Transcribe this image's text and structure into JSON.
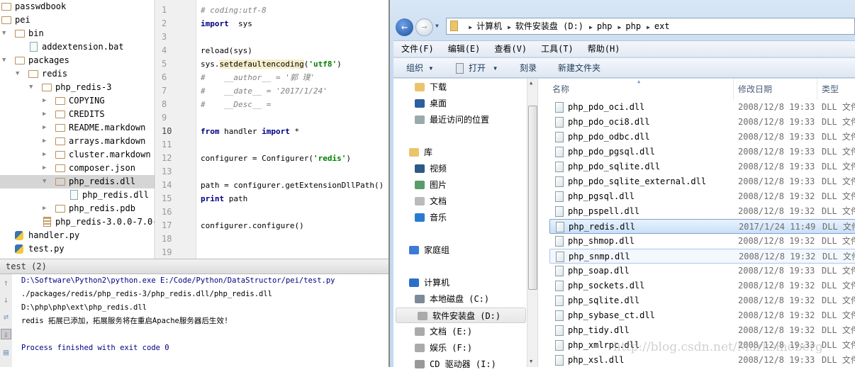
{
  "ide": {
    "tree": [
      {
        "label": "passwdbook",
        "depth": 0,
        "kind": "folder",
        "arrow": ""
      },
      {
        "label": "pei",
        "depth": 0,
        "kind": "folder",
        "arrow": ""
      },
      {
        "label": "bin",
        "depth": 1,
        "kind": "folder",
        "arrow": "▼"
      },
      {
        "label": "addextension.bat",
        "depth": 2,
        "kind": "file",
        "arrow": ""
      },
      {
        "label": "packages",
        "depth": 1,
        "kind": "folder",
        "arrow": "▼"
      },
      {
        "label": "redis",
        "depth": 2,
        "kind": "folder",
        "arrow": "▼"
      },
      {
        "label": "php_redis-3",
        "depth": 3,
        "kind": "folder",
        "arrow": "▼"
      },
      {
        "label": "COPYING",
        "depth": 4,
        "kind": "folder",
        "arrow": "▶"
      },
      {
        "label": "CREDITS",
        "depth": 4,
        "kind": "folder",
        "arrow": "▶"
      },
      {
        "label": "README.markdown",
        "depth": 4,
        "kind": "folder",
        "arrow": "▶"
      },
      {
        "label": "arrays.markdown",
        "depth": 4,
        "kind": "folder",
        "arrow": "▶"
      },
      {
        "label": "cluster.markdown",
        "depth": 4,
        "kind": "folder",
        "arrow": "▶"
      },
      {
        "label": "composer.json",
        "depth": 4,
        "kind": "folder",
        "arrow": "▶"
      },
      {
        "label": "php_redis.dll",
        "depth": 4,
        "kind": "folder",
        "arrow": "▼",
        "selected": true
      },
      {
        "label": "php_redis.dll",
        "depth": 5,
        "kind": "file",
        "arrow": ""
      },
      {
        "label": "php_redis.pdb",
        "depth": 4,
        "kind": "folder",
        "arrow": "▶"
      },
      {
        "label": "php_redis-3.0.0-7.0-",
        "depth": 3,
        "kind": "archive",
        "arrow": ""
      },
      {
        "label": "handler.py",
        "depth": 1,
        "kind": "py",
        "arrow": ""
      },
      {
        "label": "test.py",
        "depth": 1,
        "kind": "py",
        "arrow": ""
      }
    ],
    "current_line": 10,
    "code": [
      [
        [
          "cm",
          "# coding:utf-8"
        ]
      ],
      [
        [
          "kw",
          "import"
        ],
        [
          "",
          "  sys"
        ]
      ],
      [],
      [
        [
          "",
          "reload(sys)"
        ]
      ],
      [
        [
          "",
          "sys."
        ],
        [
          "hl",
          "setdefaultencoding"
        ],
        [
          "",
          "("
        ],
        [
          "str",
          "'utf8'"
        ],
        [
          "",
          ")"
        ]
      ],
      [
        [
          "cm",
          "#    __author__ = '郭 璞'"
        ]
      ],
      [
        [
          "cm",
          "#    __date__ = '2017/1/24'"
        ]
      ],
      [
        [
          "cm",
          "#    __Desc__ ="
        ]
      ],
      [],
      [
        [
          "kw",
          "from"
        ],
        [
          "",
          " handler "
        ],
        [
          "kw",
          "import"
        ],
        [
          "",
          " *"
        ]
      ],
      [],
      [
        [
          "",
          "configurer = Configurer("
        ],
        [
          "str",
          "'redis'"
        ],
        [
          "",
          ")"
        ]
      ],
      [],
      [
        [
          "",
          "path = configurer.getExtensionDllPath()"
        ]
      ],
      [
        [
          "kw",
          "print"
        ],
        [
          "",
          " path"
        ]
      ],
      [],
      [
        [
          "",
          "configurer.configure()"
        ]
      ],
      [],
      []
    ],
    "console": {
      "tab_label": "test (2)",
      "lines": [
        {
          "text": "D:\\Software\\Python2\\python.exe E:/Code/Python/DataStructor/pei/test.py",
          "color": "#000080"
        },
        {
          "text": "./packages/redis/php_redis-3/php_redis.dll/php_redis.dll",
          "color": "#000000"
        },
        {
          "text": "D:\\php\\php\\ext\\php_redis.dll",
          "color": "#000000"
        },
        {
          "text": "redis 拓展已添加，拓展服务将在重启Apache服务器后生效!",
          "color": "#000000"
        },
        {
          "text": "",
          "color": "#000000"
        },
        {
          "text": "Process finished with exit code 0",
          "color": "#000080"
        }
      ]
    }
  },
  "explorer": {
    "breadcrumb": [
      "计算机",
      "软件安装盘 (D:)",
      "php",
      "php",
      "ext"
    ],
    "menu": [
      "文件(F)",
      "编辑(E)",
      "查看(V)",
      "工具(T)",
      "帮助(H)"
    ],
    "toolbar": {
      "organize": "组织 ▾",
      "open": "打开",
      "open_caret": "▾",
      "burn": "刻录",
      "new_folder": "新建文件夹"
    },
    "nav": [
      {
        "label": "下载",
        "indent": 1,
        "icon": "download-folder-icon",
        "color": "#e9c46a"
      },
      {
        "label": "桌面",
        "indent": 1,
        "icon": "desktop-icon",
        "color": "#2c5fa0"
      },
      {
        "label": "最近访问的位置",
        "indent": 1,
        "icon": "recent-places-icon",
        "color": "#9aa"
      },
      {
        "label": "",
        "indent": 0,
        "icon": "",
        "color": ""
      },
      {
        "label": "库",
        "indent": 0,
        "icon": "library-icon",
        "color": "#e9c46a"
      },
      {
        "label": "视频",
        "indent": 1,
        "icon": "video-icon",
        "color": "#2b5a86"
      },
      {
        "label": "图片",
        "indent": 1,
        "icon": "pictures-icon",
        "color": "#5a9c6a"
      },
      {
        "label": "文档",
        "indent": 1,
        "icon": "documents-icon",
        "color": "#bbb"
      },
      {
        "label": "音乐",
        "indent": 1,
        "icon": "music-icon",
        "color": "#2a7bd0"
      },
      {
        "label": "",
        "indent": 0,
        "icon": "",
        "color": ""
      },
      {
        "label": "家庭组",
        "indent": 0,
        "icon": "homegroup-icon",
        "color": "#3c7bd6"
      },
      {
        "label": "",
        "indent": 0,
        "icon": "",
        "color": ""
      },
      {
        "label": "计算机",
        "indent": 0,
        "icon": "computer-icon",
        "color": "#2b70c8"
      },
      {
        "label": "本地磁盘 (C:)",
        "indent": 1,
        "icon": "system-drive-icon",
        "color": "#7a8a99"
      },
      {
        "label": "软件安装盘 (D:)",
        "indent": 1,
        "icon": "drive-icon",
        "color": "#aaa",
        "selected": true
      },
      {
        "label": "文档 (E:)",
        "indent": 1,
        "icon": "drive-icon",
        "color": "#aaa"
      },
      {
        "label": "娱乐 (F:)",
        "indent": 1,
        "icon": "drive-icon",
        "color": "#aaa"
      },
      {
        "label": "CD 驱动器 (I:)",
        "indent": 1,
        "icon": "cd-drive-icon",
        "color": "#999"
      }
    ],
    "columns": {
      "name": "名称",
      "date": "修改日期",
      "type": "类型"
    },
    "files": [
      {
        "name": "php_pdo_oci.dll",
        "date": "2008/12/8 19:33",
        "type": "DLL 文件"
      },
      {
        "name": "php_pdo_oci8.dll",
        "date": "2008/12/8 19:33",
        "type": "DLL 文件"
      },
      {
        "name": "php_pdo_odbc.dll",
        "date": "2008/12/8 19:33",
        "type": "DLL 文件"
      },
      {
        "name": "php_pdo_pgsql.dll",
        "date": "2008/12/8 19:33",
        "type": "DLL 文件"
      },
      {
        "name": "php_pdo_sqlite.dll",
        "date": "2008/12/8 19:33",
        "type": "DLL 文件"
      },
      {
        "name": "php_pdo_sqlite_external.dll",
        "date": "2008/12/8 19:33",
        "type": "DLL 文件"
      },
      {
        "name": "php_pgsql.dll",
        "date": "2008/12/8 19:32",
        "type": "DLL 文件"
      },
      {
        "name": "php_pspell.dll",
        "date": "2008/12/8 19:32",
        "type": "DLL 文件"
      },
      {
        "name": "php_redis.dll",
        "date": "2017/1/24 11:49",
        "type": "DLL 文件",
        "selected": true
      },
      {
        "name": "php_shmop.dll",
        "date": "2008/12/8 19:32",
        "type": "DLL 文件"
      },
      {
        "name": "php_snmp.dll",
        "date": "2008/12/8 19:32",
        "type": "DLL 文件",
        "hover": true
      },
      {
        "name": "php_soap.dll",
        "date": "2008/12/8 19:33",
        "type": "DLL 文件"
      },
      {
        "name": "php_sockets.dll",
        "date": "2008/12/8 19:32",
        "type": "DLL 文件"
      },
      {
        "name": "php_sqlite.dll",
        "date": "2008/12/8 19:32",
        "type": "DLL 文件"
      },
      {
        "name": "php_sybase_ct.dll",
        "date": "2008/12/8 19:32",
        "type": "DLL 文件"
      },
      {
        "name": "php_tidy.dll",
        "date": "2008/12/8 19:32",
        "type": "DLL 文件"
      },
      {
        "name": "php_xmlrpc.dll",
        "date": "2008/12/8 19:33",
        "type": "DLL 文件"
      },
      {
        "name": "php_xsl.dll",
        "date": "2008/12/8 19:33",
        "type": "DLL 文件"
      }
    ]
  },
  "watermark": "http://blog.csdn.net/Marksinoberg"
}
